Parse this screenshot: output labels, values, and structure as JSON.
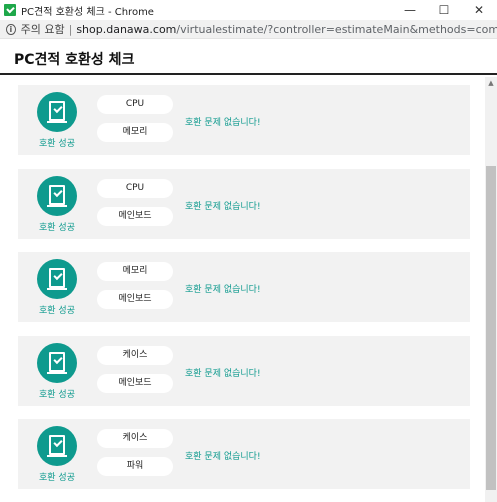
{
  "window": {
    "title": "PC견적 호환성 체크 - Chrome",
    "minimize_glyph": "—",
    "maximize_glyph": "☐",
    "close_glyph": "✕"
  },
  "address_bar": {
    "security_label": "주의 요함",
    "separator": "|",
    "url_host": "shop.danawa.com",
    "url_path": "/virtualestimate/?controller=estimateMain&methods=compatibilityView"
  },
  "page": {
    "title": "PC견적 호환성 체크"
  },
  "checks": [
    {
      "status": "호환 성공",
      "part_a": "CPU",
      "part_b": "메모리",
      "result": "호환 문제 없습니다!"
    },
    {
      "status": "호환 성공",
      "part_a": "CPU",
      "part_b": "메인보드",
      "result": "호환 문제 없습니다!"
    },
    {
      "status": "호환 성공",
      "part_a": "메모리",
      "part_b": "메인보드",
      "result": "호환 문제 없습니다!"
    },
    {
      "status": "호환 성공",
      "part_a": "케이스",
      "part_b": "메인보드",
      "result": "호환 문제 없습니다!"
    },
    {
      "status": "호환 성공",
      "part_a": "케이스",
      "part_b": "파워",
      "result": "호환 문제 없습니다!"
    }
  ],
  "icons": {
    "favicon": "danawa-check-icon",
    "status": "document-check-icon",
    "info": "info-icon"
  },
  "colors": {
    "accent": "#0e9a8e",
    "card_bg": "#f2f2f2",
    "favicon": "#1ea84a"
  }
}
